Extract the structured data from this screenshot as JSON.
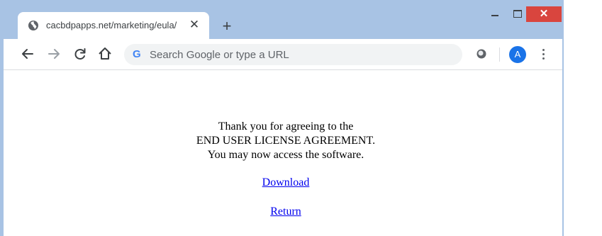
{
  "tab": {
    "title": "cacbdpapps.net/marketing/eula/",
    "close_glyph": "✕",
    "favicon": "globe-icon"
  },
  "new_tab_glyph": "+",
  "window_controls": {
    "close_glyph": "✕"
  },
  "toolbar": {
    "omnibox_placeholder": "Search Google or type a URL",
    "google_glyph": "G",
    "avatar_letter": "A"
  },
  "page": {
    "lines": [
      "Thank you for agreeing to the",
      "END USER LICENSE AGREEMENT.",
      "You may now access the software."
    ],
    "download_label": "Download",
    "return_label": "Return"
  },
  "colors": {
    "frame": "#a8c3e4",
    "close_button": "#d9453e",
    "link": "#0000ee",
    "avatar": "#1a73e8"
  }
}
